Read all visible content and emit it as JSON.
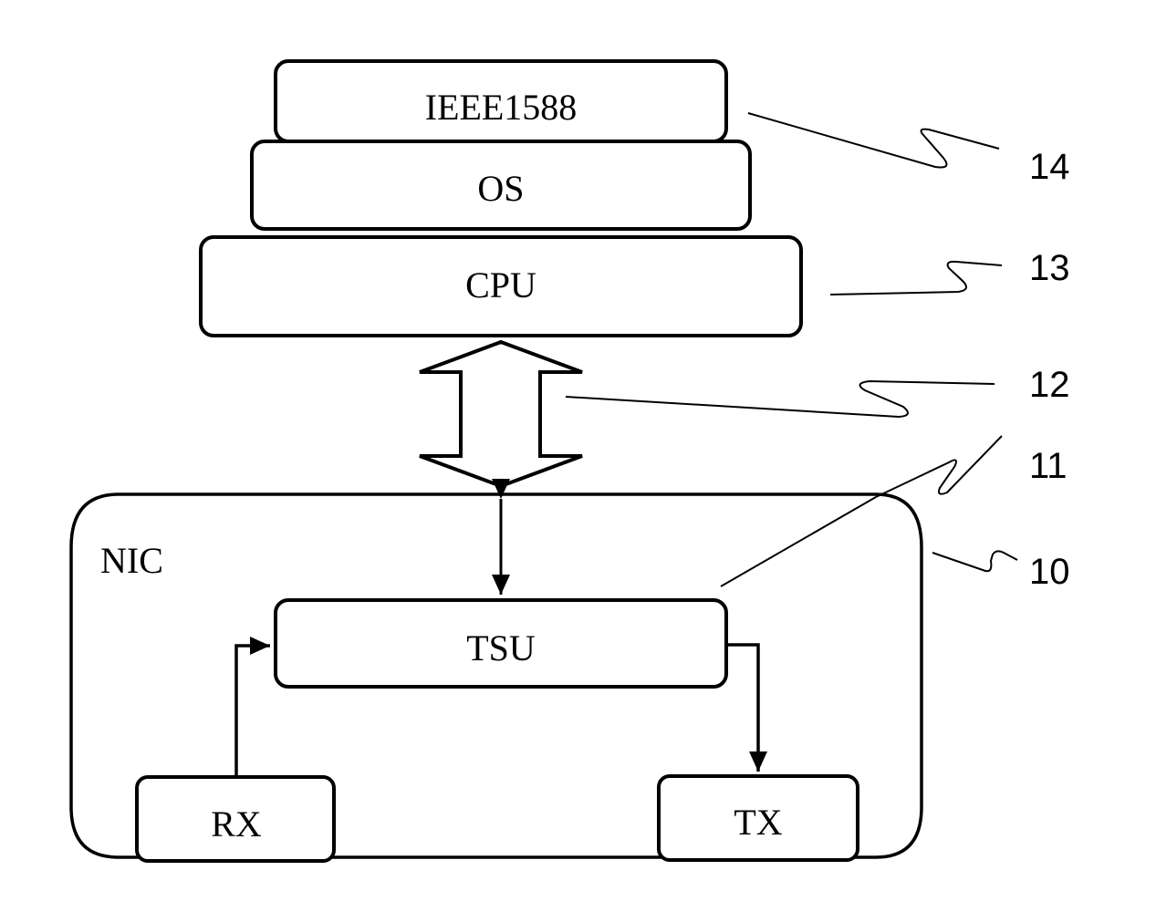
{
  "diagram": {
    "title": "",
    "blocks": {
      "ieee1588": "IEEE1588",
      "os": "OS",
      "cpu": "CPU",
      "nic": "NIC",
      "tsu": "TSU",
      "rx": "RX",
      "tx": "TX"
    },
    "reference_numerals": {
      "software_stack": "14",
      "cpu": "13",
      "bus": "12",
      "tsu": "11",
      "nic": "10"
    },
    "connections": [
      {
        "from": "CPU",
        "to": "NIC",
        "type": "bidirectional-bus-arrow"
      },
      {
        "from": "NIC",
        "to": "TSU",
        "type": "bidirectional-arrow"
      },
      {
        "from": "RX",
        "to": "TSU",
        "type": "arrow"
      },
      {
        "from": "TSU",
        "to": "TX",
        "type": "arrow"
      }
    ]
  }
}
